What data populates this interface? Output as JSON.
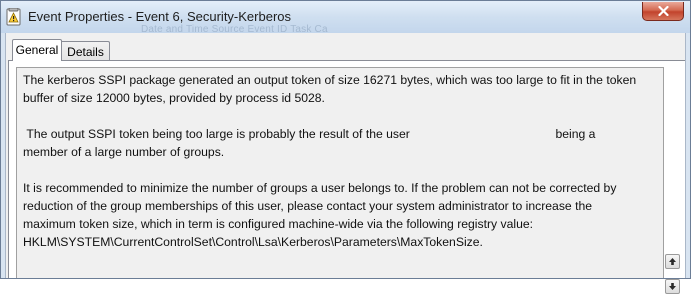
{
  "window": {
    "title": "Event Properties - Event 6, Security-Kerberos"
  },
  "background_header_hint": "Date and Time        Source        Event ID  Task Ca",
  "tabs": [
    {
      "label": "General",
      "active": true
    },
    {
      "label": "Details",
      "active": false
    }
  ],
  "description": {
    "paragraphs": [
      "The kerberos SSPI package generated an output token of size 16271 bytes, which was too large to fit in the token buffer of size 12000 bytes, provided by process id 5028.",
      " The output SSPI token being too large is probably the result of the user                                           being a member of a large number of groups.",
      " It is recommended to minimize the number of groups a user belongs to. If the problem can not be corrected by reduction of the group memberships of this user, please contact your system administrator to increase the maximum token size, which in term is configured machine-wide via the following registry value: HKLM\\SYSTEM\\CurrentControlSet\\Control\\Lsa\\Kerberos\\Parameters\\MaxTokenSize."
    ]
  },
  "icons": {
    "app": "event-viewer-icon",
    "close": "close-icon",
    "scroll_up": "arrow-up-icon",
    "scroll_down": "arrow-down-icon"
  },
  "colors": {
    "title_bar": "#cfdff0",
    "close_button": "#c2432c",
    "panel": "#ffffff",
    "content_bg": "#f0f0f0"
  }
}
